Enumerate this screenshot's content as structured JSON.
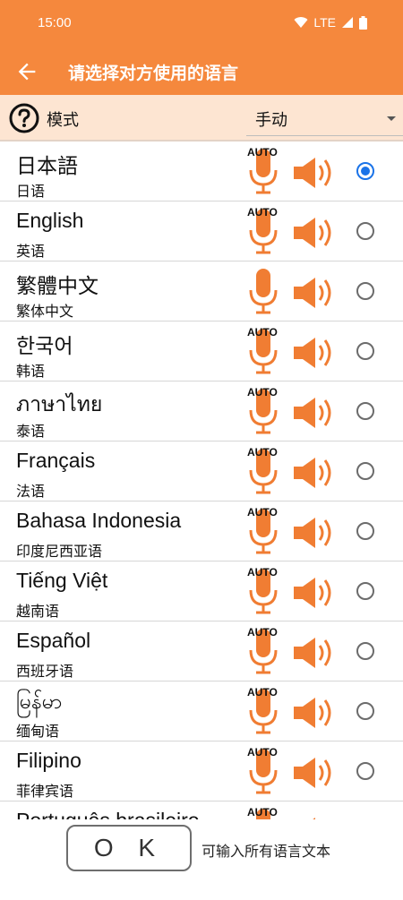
{
  "status": {
    "time": "15:00",
    "network": "LTE",
    "icons": [
      "wifi-icon",
      "cell-signal-icon",
      "battery-icon"
    ]
  },
  "appbar": {
    "title": "请选择对方使用的语言",
    "back_icon": "back-arrow-icon"
  },
  "mode": {
    "label": "模式",
    "selected": "手动",
    "help_icon": "help-circle-icon"
  },
  "languages": [
    {
      "name": "日本語",
      "sub": "日语",
      "auto": "AUTO",
      "selected": true
    },
    {
      "name": "English",
      "sub": "英语",
      "auto": "AUTO",
      "selected": false
    },
    {
      "name": "繁體中文",
      "sub": "繁体中文",
      "auto": "",
      "selected": false
    },
    {
      "name": "한국어",
      "sub": "韩语",
      "auto": "AUTO",
      "selected": false
    },
    {
      "name": "ภาษาไทย",
      "sub": "泰语",
      "auto": "AUTO",
      "selected": false
    },
    {
      "name": "Français",
      "sub": "法语",
      "auto": "AUTO",
      "selected": false
    },
    {
      "name": "Bahasa Indonesia",
      "sub": "印度尼西亚语",
      "auto": "AUTO",
      "selected": false
    },
    {
      "name": "Tiếng Việt",
      "sub": "越南语",
      "auto": "AUTO",
      "selected": false
    },
    {
      "name": "Español",
      "sub": "西班牙语",
      "auto": "AUTO",
      "selected": false
    },
    {
      "name": "မြန်မာ",
      "sub": "缅甸语",
      "auto": "AUTO",
      "selected": false
    },
    {
      "name": "Filipino",
      "sub": "菲律宾语",
      "auto": "AUTO",
      "selected": false
    },
    {
      "name": "Português brasileiro",
      "sub": "",
      "auto": "AUTO",
      "selected": false
    }
  ],
  "colors": {
    "accent": "#f5883d",
    "mode_bar": "#fde5d2",
    "radio_selected": "#1a73e8"
  },
  "bottom": {
    "ok_label": "O K",
    "hint": "可输入所有语言文本"
  }
}
